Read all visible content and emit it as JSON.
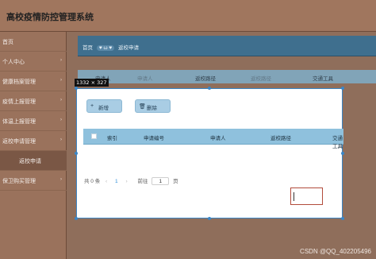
{
  "app": {
    "title": "高校疫情防控管理系统"
  },
  "sidebar": {
    "items": [
      {
        "label": "首页",
        "chevron": false
      },
      {
        "label": "个人中心",
        "chevron": true
      },
      {
        "label": "健康档案管理",
        "chevron": true
      },
      {
        "label": "疫情上报管理",
        "chevron": true
      },
      {
        "label": "体温上报管理",
        "chevron": true
      },
      {
        "label": "返校申请管理",
        "chevron": true
      },
      {
        "label": "返校申请",
        "sub": true,
        "active": true
      },
      {
        "label": "保卫购买管理",
        "chevron": true
      }
    ],
    "chevron_glyph": "›"
  },
  "breadcrumb": {
    "home": "首页",
    "middle": "♥ ω ♥",
    "current": "返校申请"
  },
  "background_table": {
    "headers": [
      "申请人",
      "申请人",
      "返校路径",
      "返校路径",
      "交通工具"
    ]
  },
  "dimension_tag": "1332 × 327",
  "toolbar": {
    "add_label": "新增",
    "add_icon": "+",
    "delete_label": "删除",
    "delete_icon": "🗑"
  },
  "table": {
    "headers": [
      "索引",
      "申请编号",
      "申请人",
      "返校路径",
      "交通工具"
    ]
  },
  "pager": {
    "total": "共 0 条",
    "prev": "‹",
    "page": "1",
    "next": "›",
    "goto_label": "前往",
    "goto_value": "1",
    "page_suffix": "页"
  },
  "watermark": "CSDN @QQ_402205496"
}
